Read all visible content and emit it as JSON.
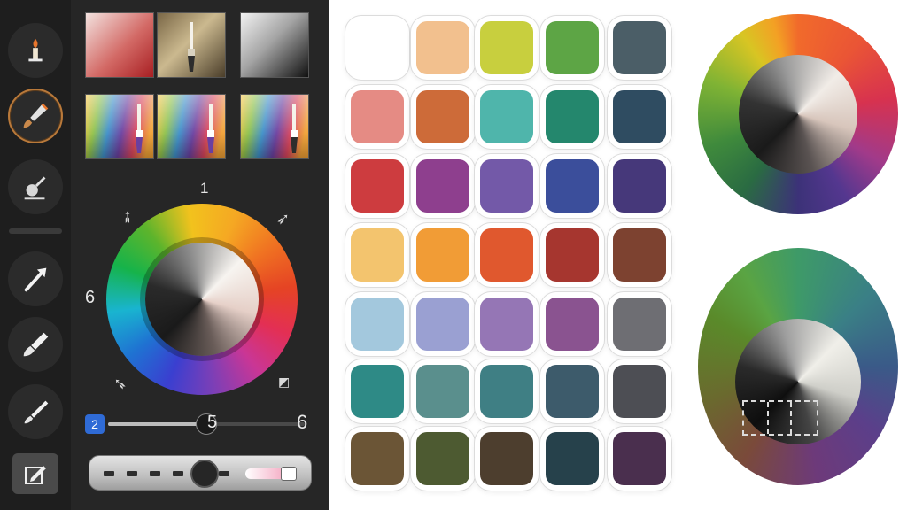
{
  "left_tools": [
    {
      "name": "candle-tool",
      "icon": "candle-icon"
    },
    {
      "name": "paintbrush-tool",
      "icon": "paintbrush-icon",
      "active": true
    },
    {
      "name": "eyedropper-tool",
      "icon": "eyedropper-icon"
    },
    {
      "name": "arrow-tool",
      "icon": "arrow-icon"
    },
    {
      "name": "brush-tool",
      "icon": "brush-icon"
    },
    {
      "name": "thin-brush-tool",
      "icon": "thin-brush-icon"
    },
    {
      "name": "edit-tool",
      "icon": "edit-icon"
    }
  ],
  "panel": {
    "markers": {
      "top": "1",
      "left": "6",
      "right": "6"
    },
    "size_slider": {
      "badge": "2",
      "value_label": "5",
      "value": 0.5
    },
    "opacity_slider": {
      "value": 0.52
    }
  },
  "swatches": [
    [
      "#ffffff",
      "#f2c08e",
      "#c8cf3e",
      "#5da545",
      "#4b5e67"
    ],
    [
      "#e58b84",
      "#cd6b39",
      "#4fb5ab",
      "#24876d",
      "#2f4c61"
    ],
    [
      "#cd3c3f",
      "#8e3f8e",
      "#7359a8",
      "#3b4e9b",
      "#46387a"
    ],
    [
      "#f3c46e",
      "#f19c36",
      "#e0582e",
      "#a6362f",
      "#7d4230"
    ],
    [
      "#a3c8dd",
      "#9aa0d2",
      "#9576b5",
      "#8a5390",
      "#6e6e73"
    ],
    [
      "#2e8a86",
      "#5a8f8d",
      "#3f7f84",
      "#3d5b6b",
      "#4d4e54"
    ],
    [
      "#6b5536",
      "#4d5a31",
      "#4d3e2e",
      "#26414b",
      "#4a2f4e"
    ]
  ],
  "colors": {
    "rail_bg": "#1e1e1e",
    "panel_bg": "#262626",
    "active_ring": "#b9793a",
    "badge_blue": "#2f6bd6"
  }
}
